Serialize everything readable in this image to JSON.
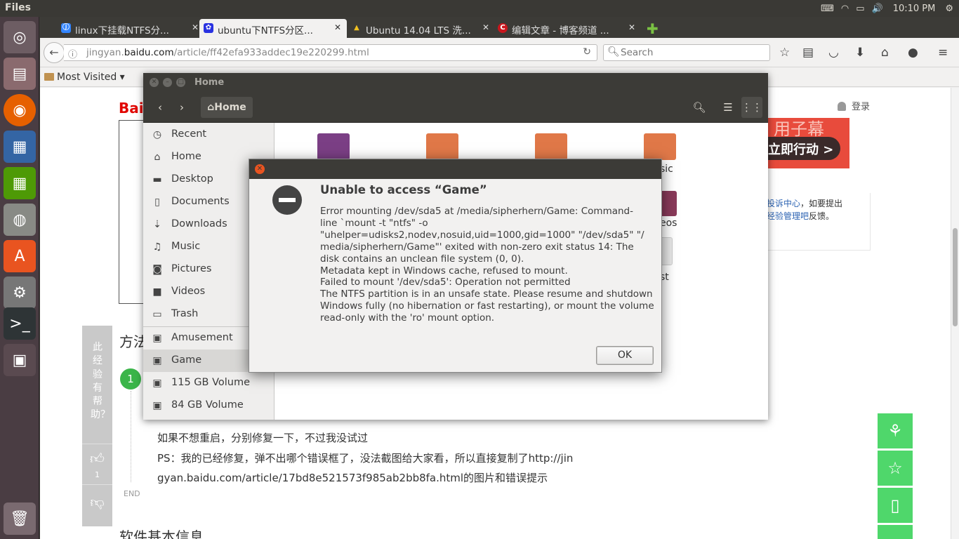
{
  "panel": {
    "app_name": "Files",
    "clock": "10:10 PM"
  },
  "browser": {
    "tabs": [
      {
        "label": "linux下挂载NTFS分...",
        "favicon_color": "#3385ff"
      },
      {
        "label": "ubuntu下NTFS分区...",
        "favicon_color": "#2932e1"
      },
      {
        "label": "Ubuntu 14.04 LTS 洗...",
        "favicon_color": "#f0c020"
      },
      {
        "label": "编辑文章 - 博客频道 ...",
        "favicon_color": "#c9171e"
      }
    ],
    "url_domain_prefix": "jingyan.",
    "url_domain": "baidu.com",
    "url_path": "/article/ff42efa933addec19e220299.html",
    "search_placeholder": "Search",
    "bookmarks_label": "Most Visited"
  },
  "page": {
    "logo": "Bai",
    "login": "登录",
    "ad_text": "用子幕",
    "ad_cta": "立即行动 >",
    "right_info_1": "投诉中心",
    "right_info_1b": "，如要提出",
    "right_info_2": "经验管理吧",
    "right_info_2b": "反馈。",
    "side_question": "此经验有帮助？",
    "like_count": "1",
    "method_title": "方法",
    "step_number": "1",
    "text_line_1": "如果不想重启，分别修复一下，不过我没试过",
    "text_line_2": "PS：我的已经修复，弹不出哪个错误框了，没法截图给大家看，所以直接复制了http://jin",
    "text_line_3": "gyan.baidu.com/article/17bd8e521573f985ab2bb8fa.html的图片和错误提示",
    "end_label": "END",
    "section_title": "软件基本信息"
  },
  "files_window": {
    "title": "Home",
    "path_button": "Home",
    "sidebar": [
      {
        "label": "Recent",
        "icon": "clock-icon"
      },
      {
        "label": "Home",
        "icon": "home-icon"
      },
      {
        "label": "Desktop",
        "icon": "folder-icon"
      },
      {
        "label": "Documents",
        "icon": "document-icon"
      },
      {
        "label": "Downloads",
        "icon": "download-icon"
      },
      {
        "label": "Music",
        "icon": "music-icon"
      },
      {
        "label": "Pictures",
        "icon": "camera-icon"
      },
      {
        "label": "Videos",
        "icon": "video-icon"
      },
      {
        "label": "Trash",
        "icon": "trash-icon"
      },
      {
        "label": "Amusement",
        "icon": "drive-icon"
      },
      {
        "label": "Game",
        "icon": "drive-icon"
      },
      {
        "label": "115 GB Volume",
        "icon": "drive-icon"
      },
      {
        "label": "84 GB Volume",
        "icon": "drive-icon"
      }
    ],
    "partial_labels": [
      "sic",
      "eos",
      "st"
    ]
  },
  "dialog": {
    "heading": "Unable to access “Game”",
    "body": "Error mounting /dev/sda5 at /media/sipherhern/Game: Command-\nline `mount -t \"ntfs\" -o\n\"uhelper=udisks2,nodev,nosuid,uid=1000,gid=1000\" \"/dev/sda5\" \"/\nmedia/sipherhern/Game\"' exited with non-zero exit status 14: The\ndisk contains an unclean file system (0, 0).\nMetadata kept in Windows cache, refused to mount.\nFailed to mount '/dev/sda5': Operation not permitted\nThe NTFS partition is in an unsafe state. Please resume and shutdown\nWindows fully (no hibernation or fast restarting), or mount the volume\nread-only with the 'ro' mount option.",
    "ok_label": "OK"
  },
  "colors": {
    "ubuntu_orange": "#e95420",
    "baidu_green": "#4fd76b",
    "panel_bg": "#3c3b37"
  }
}
